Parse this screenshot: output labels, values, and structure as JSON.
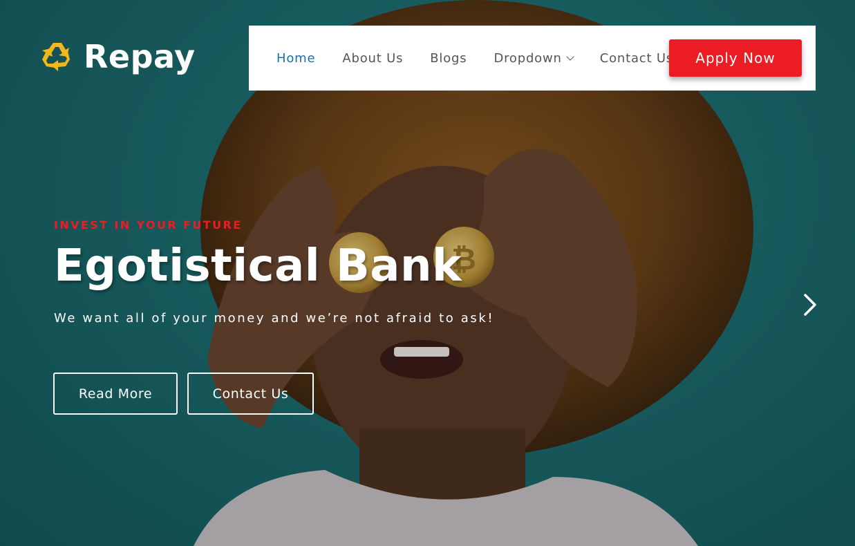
{
  "brand": {
    "name": "Repay",
    "logo_icon": "recycle-icon",
    "logo_color": "#f5b81b"
  },
  "nav": {
    "items": [
      {
        "label": "Home",
        "active": true
      },
      {
        "label": "About Us"
      },
      {
        "label": "Blogs"
      },
      {
        "label": "Dropdown",
        "has_dropdown": true,
        "icon": "chevron-down-icon"
      },
      {
        "label": "Contact Us"
      }
    ],
    "cta_label": "Apply Now",
    "active_color": "#1a6fa8",
    "cta_color": "#ec1c24"
  },
  "hero": {
    "eyebrow": "INVEST IN YOUR FUTURE",
    "title": "Egotistical Bank",
    "tagline": "We want all of your money and we’re not afraid to ask!",
    "buttons": {
      "read_more": "Read More",
      "contact_us": "Contact Us"
    },
    "next_icon": "chevron-right-icon",
    "background_color": "#1d6f72",
    "image_subject": "person-holding-bitcoins-over-eyes"
  }
}
